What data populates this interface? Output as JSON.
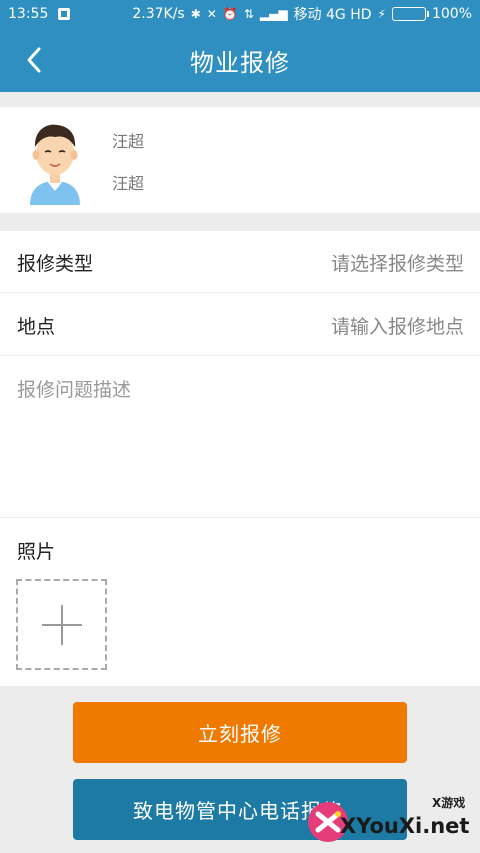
{
  "status_bar": {
    "time": "13:55",
    "speed": "2.37K/s",
    "carrier": "移动 4G HD",
    "battery": "100%",
    "battery_level": 1.0
  },
  "header": {
    "title": "物业报修"
  },
  "profile": {
    "name_line1": "汪超",
    "name_line2": "汪超"
  },
  "form": {
    "type_label": "报修类型",
    "type_placeholder": "请选择报修类型",
    "location_label": "地点",
    "location_placeholder": "请输入报修地点",
    "description_placeholder": "报修问题描述",
    "photo_label": "照片"
  },
  "buttons": {
    "report_label": "立刻报修",
    "call_label": "致电物管中心电话报修"
  },
  "watermark": {
    "small": "X游戏",
    "text": "XYouXi.net"
  },
  "colors": {
    "primary": "#2f8fc0",
    "report_button": "#f07a00",
    "call_button": "#1c7aa4",
    "background": "#ececec"
  }
}
